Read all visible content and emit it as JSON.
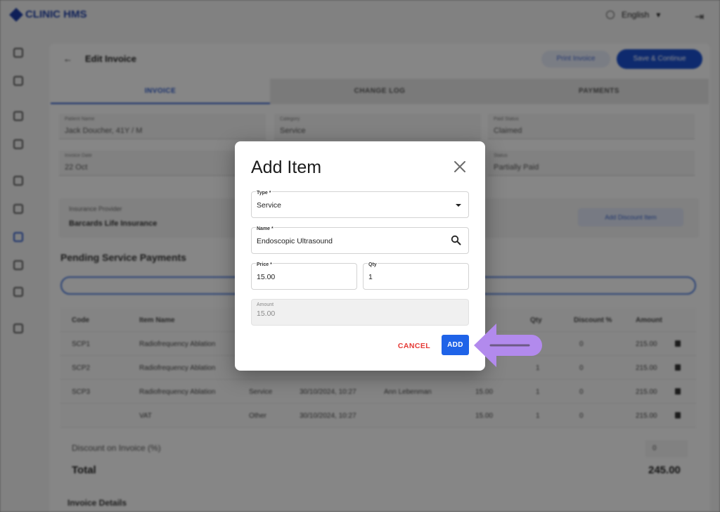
{
  "background": {
    "brand": "CLINIC HMS",
    "brand_sub": "",
    "language": "English",
    "header": {
      "title": "Edit Invoice",
      "print_label": "Print Invoice",
      "save_label": "Save & Continue"
    },
    "tabs": [
      {
        "label": "INVOICE"
      },
      {
        "label": "CHANGE LOG"
      },
      {
        "label": "PAYMENTS"
      }
    ],
    "fields": {
      "patient_label": "Patient Name",
      "patient_value": "Jack Doucher, 41Y / M",
      "category_label": "Category",
      "category_value": "Service",
      "payment_label": "Paid Status",
      "payment_value": "Claimed",
      "invoice_date_label": "Invoice Date",
      "invoice_date_value": "22 Oct",
      "status_label": "Status",
      "status_value": "Partially Paid"
    },
    "insurance": {
      "label": "Insurance Provider",
      "value": "Barcards Life Insurance",
      "add_discount": "Add Discount Item"
    },
    "section_title": "Pending Service Payments",
    "table": {
      "headers": [
        "Code",
        "Item Name",
        "Qty",
        "Discount %",
        "Amount"
      ],
      "rows": [
        {
          "code": "SCP1",
          "name": "Radiofrequency Ablation",
          "type": "",
          "date": "",
          "doctor": "",
          "price": "",
          "qty": "",
          "disc": "0",
          "amount": "215.00"
        },
        {
          "code": "SCP2",
          "name": "Radiofrequency Ablation",
          "type": "",
          "date": "",
          "doctor": "",
          "price": "",
          "qty": "1",
          "disc": "0",
          "amount": "215.00"
        },
        {
          "code": "SCP3",
          "name": "Radiofrequency Ablation",
          "type": "Service",
          "date": "30/10/2024, 10:27",
          "doctor": "Ann Lebenman",
          "price": "15.00",
          "qty": "1",
          "disc": "0",
          "amount": "215.00"
        },
        {
          "code": "",
          "name": "VAT",
          "type": "Other",
          "date": "30/10/2024, 10:27",
          "doctor": "",
          "price": "15.00",
          "qty": "1",
          "disc": "0",
          "amount": "215.00"
        }
      ]
    },
    "discount_line": "Discount on Invoice (%)",
    "discount_value": "0",
    "total_label": "Total",
    "total_value": "245.00",
    "invoice_details": "Invoice Details"
  },
  "dialog": {
    "title": "Add Item",
    "type": {
      "label": "Type *",
      "value": "Service"
    },
    "name": {
      "label": "Name *",
      "value": "Endoscopic Ultrasound"
    },
    "price": {
      "label": "Price *",
      "value": "15.00"
    },
    "qty": {
      "label": "Qty",
      "value": "1"
    },
    "amount": {
      "label": "Amount",
      "value": "15.00"
    },
    "cancel_label": "CANCEL",
    "add_label": "ADD"
  },
  "colors": {
    "primary": "#1f63e8",
    "cancel": "#e53935",
    "pointer": "#b28aed"
  }
}
